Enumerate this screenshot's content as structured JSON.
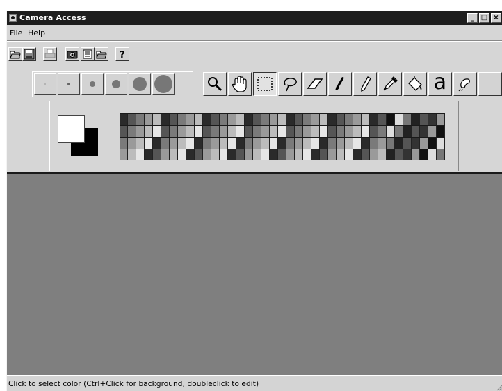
{
  "window": {
    "title": "Camera Access",
    "controls": [
      "minimize-icon",
      "maximize-icon",
      "close-icon"
    ]
  },
  "menu": {
    "items": [
      {
        "label": "File",
        "mnemonic": "F"
      },
      {
        "label": "Help",
        "mnemonic": "H"
      }
    ]
  },
  "toolbar": {
    "buttons": [
      "open-icon",
      "save-icon",
      "print-icon",
      "camera-icon",
      "image-list-icon",
      "open-folder-icon",
      "help-icon"
    ]
  },
  "brush_sizes": [
    "size-1",
    "size-2",
    "size-3",
    "size-4",
    "size-5",
    "size-6"
  ],
  "tools": {
    "items": [
      "zoom-icon",
      "hand-icon",
      "rectangle-select-icon",
      "lasso-icon",
      "eraser-icon",
      "brush-icon",
      "pencil-icon",
      "eyedropper-icon",
      "fill-bucket-icon",
      "text-icon",
      "airbrush-icon"
    ],
    "text_tool_glyph": "a",
    "selected": "rectangle-select-icon"
  },
  "colors": {
    "foreground": "#ffffff",
    "background": "#000000",
    "canvas": "#7f7f7f"
  },
  "status": {
    "text": "Click to select color (Ctrl+Click for background, doubleclick to edit)"
  }
}
